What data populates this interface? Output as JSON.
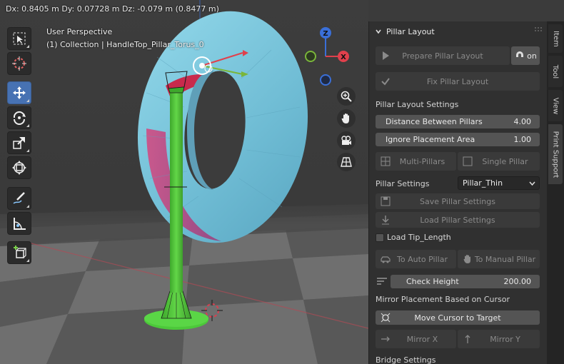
{
  "viewport": {
    "status_readout": "Dx: 0.8405 m   Dy: 0.07728 m   Dz: -0.079 m (0.8477 m)",
    "view_name": "User Perspective",
    "collection_label": "(1) Collection | HandleTop_Pillar_Torus_0",
    "gizmo": {
      "x": "X",
      "z": "Z"
    },
    "tools": [
      {
        "name": "select-box",
        "icon": "select-box-icon"
      },
      {
        "name": "cursor",
        "icon": "cursor-icon"
      },
      {
        "name": "move",
        "icon": "move-icon",
        "active": true
      },
      {
        "name": "rotate",
        "icon": "rotate-icon"
      },
      {
        "name": "scale",
        "icon": "scale-icon"
      },
      {
        "name": "transform",
        "icon": "transform-icon"
      },
      {
        "name": "annotate",
        "icon": "annotate-icon"
      },
      {
        "name": "measure",
        "icon": "measure-icon"
      },
      {
        "name": "add-cube",
        "icon": "add-cube-icon"
      }
    ],
    "nav_buttons": [
      "zoom-icon",
      "hand-icon",
      "camera-icon",
      "grid-icon"
    ]
  },
  "panel": {
    "title": "Pillar Layout",
    "prepare_button": "Prepare Pillar Layout",
    "toggle_label": "on",
    "fix_button": "Fix Pillar Layout",
    "settings_heading": "Pillar Layout Settings",
    "distance": {
      "label": "Distance Between Pillars",
      "value": "4.00"
    },
    "ignore": {
      "label": "Ignore Placement Area",
      "value": "1.00"
    },
    "multi_pillars": "Multi-Pillars",
    "single_pillar": "Single Pillar",
    "pillar_settings_label": "Pillar Settings",
    "pillar_settings_value": "Pillar_Thin",
    "save_button": "Save Pillar Settings",
    "load_button": "Load Pillar Settings",
    "load_tip_label": "Load Tip_Length",
    "to_auto": "To Auto Pillar",
    "to_manual": "To Manual Pillar",
    "check_height": {
      "label": "Check Height",
      "value": "200.00"
    },
    "mirror_heading": "Mirror Placement Based on Cursor",
    "move_cursor": "Move Cursor to Target",
    "mirror_x": "Mirror X",
    "mirror_y": "Mirror Y",
    "bridge_heading": "Bridge Settings"
  },
  "tabs": [
    {
      "label": "Item"
    },
    {
      "label": "Tool"
    },
    {
      "label": "View"
    },
    {
      "label": "Print Support",
      "active": true
    }
  ],
  "colors": {
    "torus_main": "#7ec8dc",
    "torus_shade": "#c13a78",
    "pillar": "#4fc43a",
    "accent_blue": "#4772b3",
    "axis_x": "#e0404c",
    "axis_z": "#3a6fd8",
    "axis_y": "#7ab63a"
  }
}
